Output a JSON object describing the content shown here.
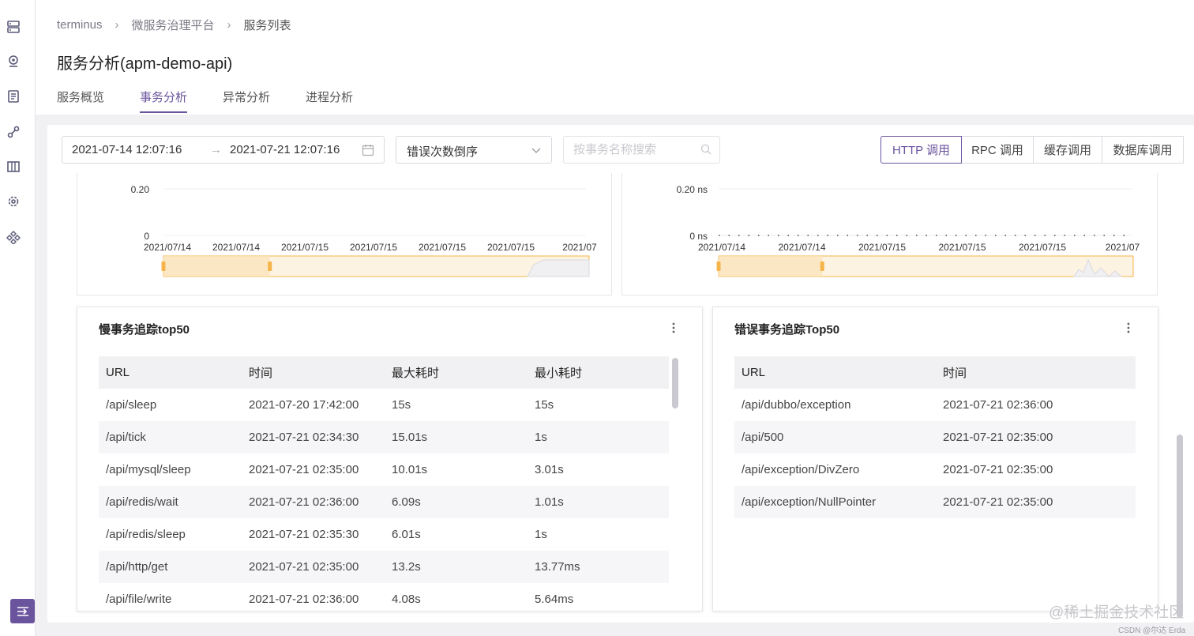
{
  "sidebar": {
    "icons": [
      "server-icon",
      "location-icon",
      "document-icon",
      "link-icon",
      "book-icon",
      "settings-icon",
      "apps-icon"
    ],
    "toggle_icon": "collapse-menu-icon"
  },
  "breadcrumb": {
    "items": [
      "terminus",
      "微服务治理平台",
      "服务列表"
    ],
    "separator": "›"
  },
  "page": {
    "title": "服务分析(apm-demo-api)"
  },
  "tabs": [
    {
      "label": "服务概览",
      "active": false
    },
    {
      "label": "事务分析",
      "active": true
    },
    {
      "label": "异常分析",
      "active": false
    },
    {
      "label": "进程分析",
      "active": false
    }
  ],
  "toolbar": {
    "range_start": "2021-07-14 12:07:16",
    "range_arrow": "→",
    "range_end": "2021-07-21 12:07:16",
    "sort_value": "错误次数倒序",
    "search_placeholder": "按事务名称搜索",
    "call_types": [
      {
        "label": "HTTP 调用",
        "active": true
      },
      {
        "label": "RPC 调用",
        "active": false
      },
      {
        "label": "缓存调用",
        "active": false
      },
      {
        "label": "数据库调用",
        "active": false
      }
    ]
  },
  "chart_data": [
    {
      "type": "line",
      "x": [
        "2021/07/14",
        "2021/07/14",
        "2021/07/15",
        "2021/07/15",
        "2021/07/15",
        "2021/07/15",
        "2021/07"
      ],
      "y_ticks": [
        "0.20",
        "0"
      ],
      "ylim": [
        0,
        0.2
      ],
      "series": [
        {
          "values": [
            0,
            0,
            0,
            0,
            0,
            0,
            0
          ]
        }
      ],
      "slider_range": [
        0,
        0.25
      ]
    },
    {
      "type": "line",
      "x": [
        "2021/07/14",
        "2021/07/14",
        "2021/07/15",
        "2021/07/15",
        "2021/07/15",
        "2021/07"
      ],
      "y_ticks": [
        "0.20 ns",
        "0 ns"
      ],
      "ylim": [
        0,
        0.2
      ],
      "series": [
        {
          "values": [
            0,
            0,
            0,
            0,
            0,
            0
          ]
        }
      ],
      "slider_range": [
        0,
        0.25
      ]
    }
  ],
  "slow_table": {
    "title": "慢事务追踪top50",
    "columns": [
      "URL",
      "时间",
      "最大耗时",
      "最小耗时"
    ],
    "rows": [
      [
        "/api/sleep",
        "2021-07-20 17:42:00",
        "15s",
        "15s"
      ],
      [
        "/api/tick",
        "2021-07-21 02:34:30",
        "15.01s",
        "1s"
      ],
      [
        "/api/mysql/sleep",
        "2021-07-21 02:35:00",
        "10.01s",
        "3.01s"
      ],
      [
        "/api/redis/wait",
        "2021-07-21 02:36:00",
        "6.09s",
        "1.01s"
      ],
      [
        "/api/redis/sleep",
        "2021-07-21 02:35:30",
        "6.01s",
        "1s"
      ],
      [
        "/api/http/get",
        "2021-07-21 02:35:00",
        "13.2s",
        "13.77ms"
      ],
      [
        "/api/file/write",
        "2021-07-21 02:36:00",
        "4.08s",
        "5.64ms"
      ]
    ]
  },
  "error_table": {
    "title": "错误事务追踪Top50",
    "columns": [
      "URL",
      "时间"
    ],
    "rows": [
      [
        "/api/dubbo/exception",
        "2021-07-21 02:36:00"
      ],
      [
        "/api/500",
        "2021-07-21 02:35:00"
      ],
      [
        "/api/exception/DivZero",
        "2021-07-21 02:35:00"
      ],
      [
        "/api/exception/NullPointer",
        "2021-07-21 02:35:00"
      ]
    ]
  },
  "watermark": "@稀土掘金技术社区",
  "watermark2": "CSDN @尔达 Erda",
  "colors": {
    "accent": "#6a549e",
    "slider": "#f5b54a"
  }
}
